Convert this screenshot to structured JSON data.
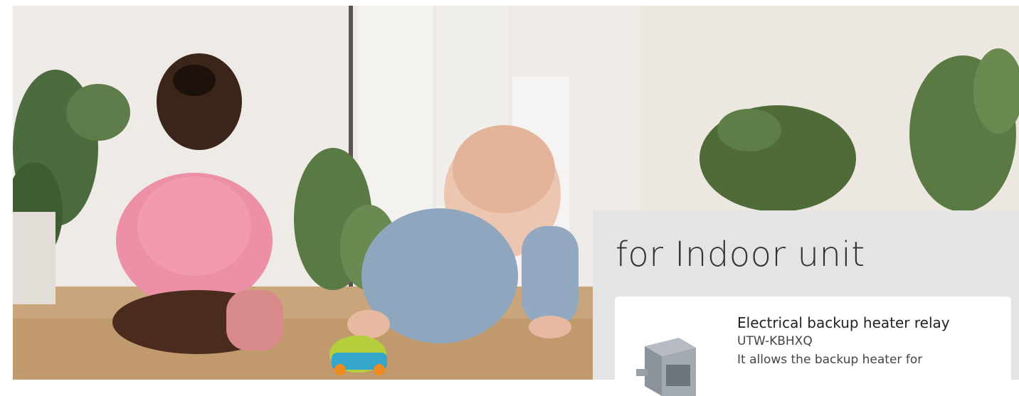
{
  "section": {
    "title": "for Indoor unit"
  },
  "accessory": {
    "name": "Electrical backup heater relay",
    "code": "UTW-KBHXQ",
    "description": "It allows the backup heater for"
  },
  "colors": {
    "panel_bg": "#e3e4e6",
    "card_bg": "#ffffff",
    "text_dark": "#333333"
  }
}
